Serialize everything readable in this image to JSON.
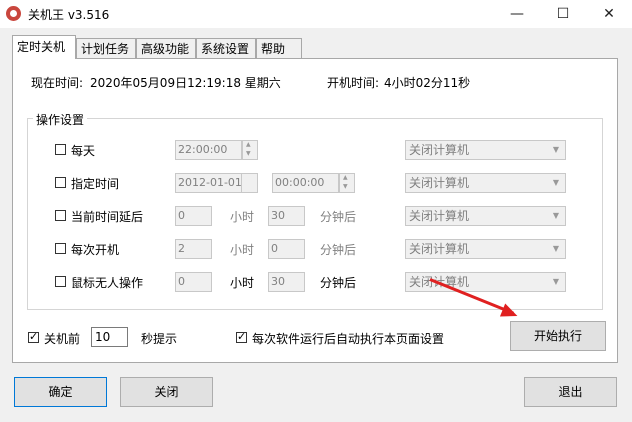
{
  "window": {
    "title": "关机王 v3.516",
    "minimize": "—",
    "maximize": "☐",
    "close": "✕"
  },
  "tabs": [
    "定时关机",
    "计划任务",
    "高级功能",
    "系统设置",
    "帮助"
  ],
  "status": {
    "current_time_label": "现在时间:",
    "current_time": "2020年05月09日12:19:18 星期六",
    "uptime_label": "开机时间:",
    "uptime": "4小时02分11秒"
  },
  "group": {
    "title": "操作设置"
  },
  "rows": [
    {
      "label": "每天",
      "field": "22:00:00",
      "action": "关闭计算机"
    },
    {
      "label": "指定时间",
      "date": "2012-01-01",
      "time": "00:00:00",
      "action": "关闭计算机"
    },
    {
      "label": "当前时间延后",
      "hours": "0",
      "hours_unit": "小时",
      "minutes": "30",
      "minutes_unit": "分钟后",
      "action": "关闭计算机"
    },
    {
      "label": "每次开机",
      "hours": "2",
      "hours_unit": "小时",
      "minutes": "0",
      "minutes_unit": "分钟后",
      "action": "关闭计算机"
    },
    {
      "label": "鼠标无人操作",
      "hours": "0",
      "hours_unit": "小时",
      "minutes": "30",
      "minutes_unit": "分钟后",
      "action": "关闭计算机"
    }
  ],
  "bottom": {
    "before_shutdown_label": "关机前",
    "before_shutdown_value": "10",
    "seconds_label": "秒提示",
    "auto_run_label": "每次软件运行后自动执行本页面设置",
    "start_button": "开始执行"
  },
  "footer": {
    "ok": "确定",
    "close": "关闭",
    "exit": "退出"
  }
}
